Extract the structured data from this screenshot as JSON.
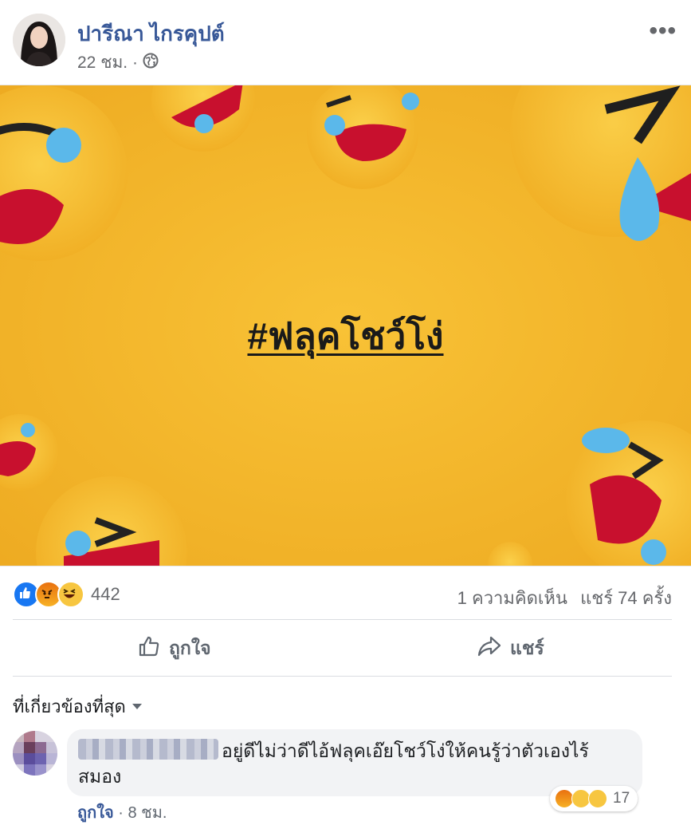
{
  "post": {
    "author": "ปารีณา ไกรคุปต์",
    "time": "22 ชม. ·",
    "privacy_icon": "globe-icon",
    "menu_icon": "more-dots-icon",
    "image_text": "#ฟลุคโชว์โง่"
  },
  "stats": {
    "reaction_icons": [
      "like-icon",
      "angry-icon",
      "haha-icon"
    ],
    "reaction_count": "442",
    "comments": "1 ความคิดเห็น",
    "shares": "แชร์ 74 ครั้ง"
  },
  "actions": {
    "like": "ถูกใจ",
    "share": "แชร์"
  },
  "comments_section": {
    "sort_label": "ที่เกี่ยวข้องที่สุด",
    "comment": {
      "text": "อยู่ดีไม่ว่าดีไอ้ฟลุคเอ๊ยโชว์โง่ให้คนรู้ว่าตัวเองไร้สมอง",
      "reaction_icons": [
        "angry-icon",
        "haha-icon",
        "wow-icon"
      ],
      "reaction_count": "17",
      "like_label": "ถูกใจ",
      "time": "· 8 ชม."
    }
  },
  "colors": {
    "accent": "#385898",
    "image_background": "#f3b62b",
    "like_blue": "#1877f2",
    "angry_orange": "#e9710f"
  }
}
